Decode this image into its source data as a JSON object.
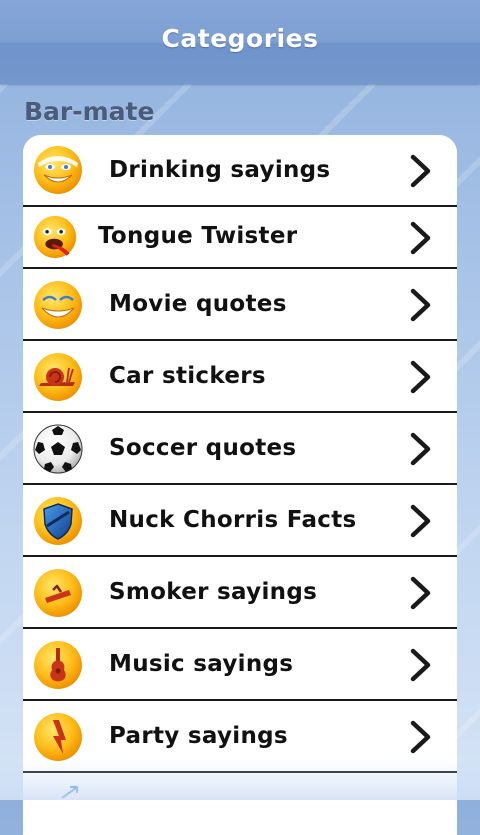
{
  "header": {
    "title": "Categories"
  },
  "section": {
    "label": "Bar-mate"
  },
  "categories": [
    {
      "label": "Drinking sayings",
      "icon": "drinking-smiley-icon"
    },
    {
      "label": "Tongue Twister",
      "icon": "tongue-smiley-icon"
    },
    {
      "label": "Movie quotes",
      "icon": "grinning-smiley-icon"
    },
    {
      "label": "Car stickers",
      "icon": "snail-icon"
    },
    {
      "label": "Soccer quotes",
      "icon": "soccer-ball-icon"
    },
    {
      "label": "Nuck Chorris Facts",
      "icon": "shield-icon"
    },
    {
      "label": "Smoker sayings",
      "icon": "cigarette-icon"
    },
    {
      "label": "Music sayings",
      "icon": "guitar-icon"
    },
    {
      "label": "Party sayings",
      "icon": "lightning-icon"
    }
  ],
  "colors": {
    "titlebar": "#7d9fd3",
    "section_label": "#4a5b7c",
    "row_divider": "#1a1a1a"
  }
}
